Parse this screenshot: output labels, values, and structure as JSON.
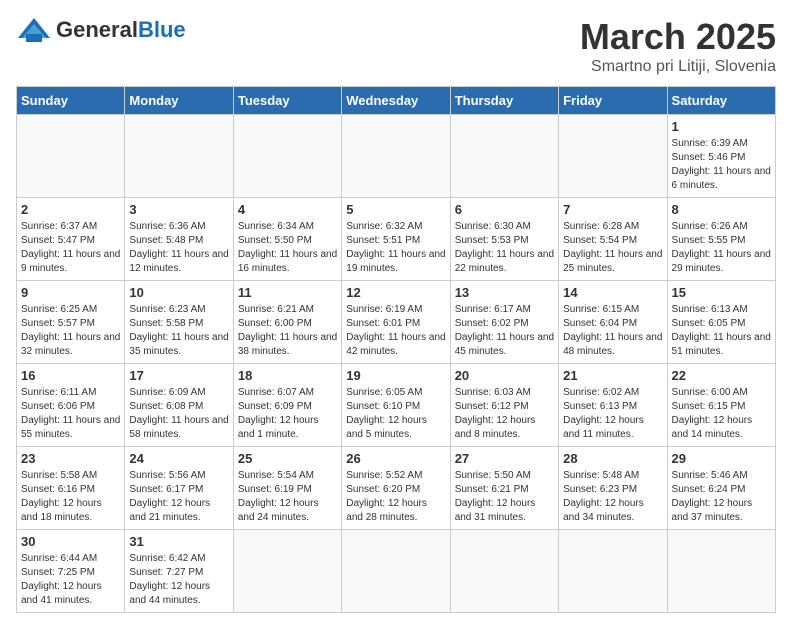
{
  "logo": {
    "text_general": "General",
    "text_blue": "Blue"
  },
  "title": {
    "month": "March 2025",
    "location": "Smartno pri Litiji, Slovenia"
  },
  "headers": [
    "Sunday",
    "Monday",
    "Tuesday",
    "Wednesday",
    "Thursday",
    "Friday",
    "Saturday"
  ],
  "weeks": [
    [
      {
        "day": "",
        "info": ""
      },
      {
        "day": "",
        "info": ""
      },
      {
        "day": "",
        "info": ""
      },
      {
        "day": "",
        "info": ""
      },
      {
        "day": "",
        "info": ""
      },
      {
        "day": "",
        "info": ""
      },
      {
        "day": "1",
        "info": "Sunrise: 6:39 AM\nSunset: 5:46 PM\nDaylight: 11 hours and 6 minutes."
      }
    ],
    [
      {
        "day": "2",
        "info": "Sunrise: 6:37 AM\nSunset: 5:47 PM\nDaylight: 11 hours and 9 minutes."
      },
      {
        "day": "3",
        "info": "Sunrise: 6:36 AM\nSunset: 5:48 PM\nDaylight: 11 hours and 12 minutes."
      },
      {
        "day": "4",
        "info": "Sunrise: 6:34 AM\nSunset: 5:50 PM\nDaylight: 11 hours and 16 minutes."
      },
      {
        "day": "5",
        "info": "Sunrise: 6:32 AM\nSunset: 5:51 PM\nDaylight: 11 hours and 19 minutes."
      },
      {
        "day": "6",
        "info": "Sunrise: 6:30 AM\nSunset: 5:53 PM\nDaylight: 11 hours and 22 minutes."
      },
      {
        "day": "7",
        "info": "Sunrise: 6:28 AM\nSunset: 5:54 PM\nDaylight: 11 hours and 25 minutes."
      },
      {
        "day": "8",
        "info": "Sunrise: 6:26 AM\nSunset: 5:55 PM\nDaylight: 11 hours and 29 minutes."
      }
    ],
    [
      {
        "day": "9",
        "info": "Sunrise: 6:25 AM\nSunset: 5:57 PM\nDaylight: 11 hours and 32 minutes."
      },
      {
        "day": "10",
        "info": "Sunrise: 6:23 AM\nSunset: 5:58 PM\nDaylight: 11 hours and 35 minutes."
      },
      {
        "day": "11",
        "info": "Sunrise: 6:21 AM\nSunset: 6:00 PM\nDaylight: 11 hours and 38 minutes."
      },
      {
        "day": "12",
        "info": "Sunrise: 6:19 AM\nSunset: 6:01 PM\nDaylight: 11 hours and 42 minutes."
      },
      {
        "day": "13",
        "info": "Sunrise: 6:17 AM\nSunset: 6:02 PM\nDaylight: 11 hours and 45 minutes."
      },
      {
        "day": "14",
        "info": "Sunrise: 6:15 AM\nSunset: 6:04 PM\nDaylight: 11 hours and 48 minutes."
      },
      {
        "day": "15",
        "info": "Sunrise: 6:13 AM\nSunset: 6:05 PM\nDaylight: 11 hours and 51 minutes."
      }
    ],
    [
      {
        "day": "16",
        "info": "Sunrise: 6:11 AM\nSunset: 6:06 PM\nDaylight: 11 hours and 55 minutes."
      },
      {
        "day": "17",
        "info": "Sunrise: 6:09 AM\nSunset: 6:08 PM\nDaylight: 11 hours and 58 minutes."
      },
      {
        "day": "18",
        "info": "Sunrise: 6:07 AM\nSunset: 6:09 PM\nDaylight: 12 hours and 1 minute."
      },
      {
        "day": "19",
        "info": "Sunrise: 6:05 AM\nSunset: 6:10 PM\nDaylight: 12 hours and 5 minutes."
      },
      {
        "day": "20",
        "info": "Sunrise: 6:03 AM\nSunset: 6:12 PM\nDaylight: 12 hours and 8 minutes."
      },
      {
        "day": "21",
        "info": "Sunrise: 6:02 AM\nSunset: 6:13 PM\nDaylight: 12 hours and 11 minutes."
      },
      {
        "day": "22",
        "info": "Sunrise: 6:00 AM\nSunset: 6:15 PM\nDaylight: 12 hours and 14 minutes."
      }
    ],
    [
      {
        "day": "23",
        "info": "Sunrise: 5:58 AM\nSunset: 6:16 PM\nDaylight: 12 hours and 18 minutes."
      },
      {
        "day": "24",
        "info": "Sunrise: 5:56 AM\nSunset: 6:17 PM\nDaylight: 12 hours and 21 minutes."
      },
      {
        "day": "25",
        "info": "Sunrise: 5:54 AM\nSunset: 6:19 PM\nDaylight: 12 hours and 24 minutes."
      },
      {
        "day": "26",
        "info": "Sunrise: 5:52 AM\nSunset: 6:20 PM\nDaylight: 12 hours and 28 minutes."
      },
      {
        "day": "27",
        "info": "Sunrise: 5:50 AM\nSunset: 6:21 PM\nDaylight: 12 hours and 31 minutes."
      },
      {
        "day": "28",
        "info": "Sunrise: 5:48 AM\nSunset: 6:23 PM\nDaylight: 12 hours and 34 minutes."
      },
      {
        "day": "29",
        "info": "Sunrise: 5:46 AM\nSunset: 6:24 PM\nDaylight: 12 hours and 37 minutes."
      }
    ],
    [
      {
        "day": "30",
        "info": "Sunrise: 6:44 AM\nSunset: 7:25 PM\nDaylight: 12 hours and 41 minutes."
      },
      {
        "day": "31",
        "info": "Sunrise: 6:42 AM\nSunset: 7:27 PM\nDaylight: 12 hours and 44 minutes."
      },
      {
        "day": "",
        "info": ""
      },
      {
        "day": "",
        "info": ""
      },
      {
        "day": "",
        "info": ""
      },
      {
        "day": "",
        "info": ""
      },
      {
        "day": "",
        "info": ""
      }
    ]
  ]
}
